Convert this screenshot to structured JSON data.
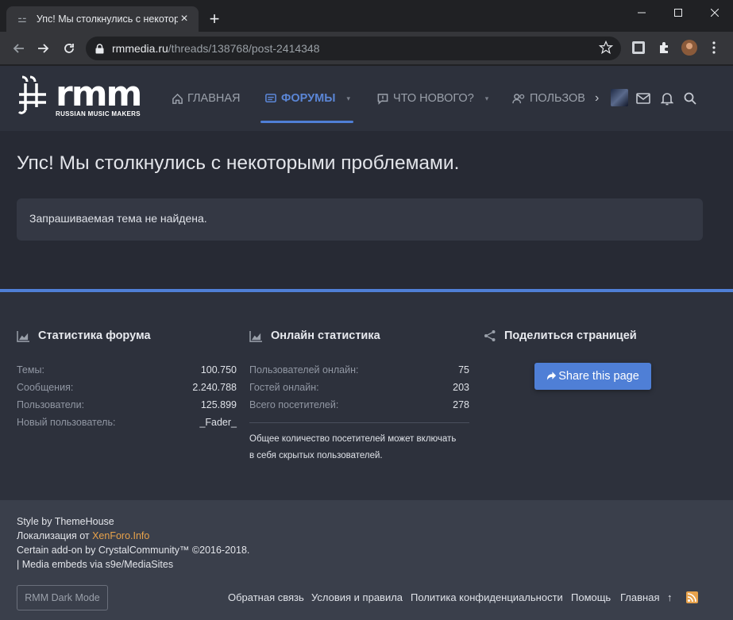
{
  "browser": {
    "tab_title": "Упс! Мы столкнулись с некоторы",
    "url_domain": "rmmedia.ru",
    "url_path": "/threads/138768/post-2414348"
  },
  "site": {
    "logo_text": "rmm",
    "logo_subtext": "RUSSIAN MUSIC MAKERS",
    "nav": [
      {
        "label": "ГЛАВНАЯ",
        "icon": "home-icon"
      },
      {
        "label": "ФОРУМЫ",
        "icon": "forum-icon",
        "active": true
      },
      {
        "label": "ЧТО НОВОГО?",
        "icon": "whats-new-icon"
      },
      {
        "label": "ПОЛЬЗОВ",
        "icon": "users-icon"
      }
    ],
    "accent_color": "#4f7fd6"
  },
  "error": {
    "title": "Упс! Мы столкнулись с некоторыми проблемами.",
    "message": "Запрашиваемая тема не найдена."
  },
  "footer": {
    "forum_stats": {
      "heading": "Статистика форума",
      "rows": [
        {
          "key": "Темы:",
          "value": "100.750"
        },
        {
          "key": "Сообщения:",
          "value": "2.240.788"
        },
        {
          "key": "Пользователи:",
          "value": "125.899"
        },
        {
          "key": "Новый пользователь:",
          "value": "_Fader_"
        }
      ]
    },
    "online_stats": {
      "heading": "Онлайн статистика",
      "rows": [
        {
          "key": "Пользователей онлайн:",
          "value": "75"
        },
        {
          "key": "Гостей онлайн:",
          "value": "203"
        },
        {
          "key": "Всего посетителей:",
          "value": "278"
        }
      ],
      "note_line1": "Общее количество посетителей может включать",
      "note_line2": "в себя скрытых пользователей."
    },
    "share": {
      "heading": "Поделиться страницей",
      "button": "Share this page"
    }
  },
  "bottom": {
    "credit1": "Style by ThemeHouse",
    "credit2_prefix": "Локализация от ",
    "credit2_link": "XenForo.Info",
    "credit3": "Certain add-on by CrystalCommunity™ ©2016-2018.",
    "credit4": "| Media embeds via s9e/MediaSites",
    "dark_mode": "RMM Dark Mode",
    "links": [
      "Обратная связь",
      "Условия и правила",
      "Политика конфиденциальности",
      "Помощь",
      "Главная"
    ]
  }
}
